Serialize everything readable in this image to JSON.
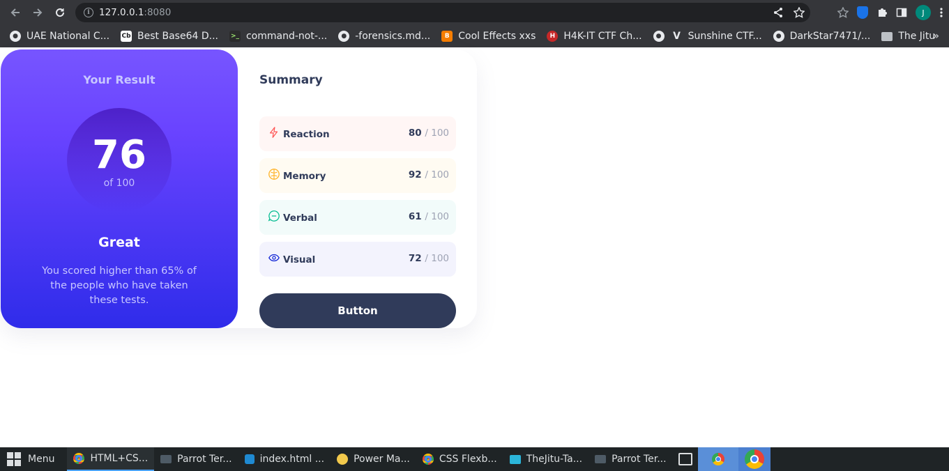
{
  "browser": {
    "url_host": "127.0.0.1",
    "url_port": ":8080",
    "avatar_letter": "J",
    "bookmarks": [
      {
        "label": "UAE National C...",
        "icon": "globe-icon",
        "color": "#e8eaed"
      },
      {
        "label": "Best Base64 D...",
        "icon": "cb-icon",
        "color": "#ffffff"
      },
      {
        "label": "command-not-...",
        "icon": "terminal-icon",
        "color": "#2b2b2b"
      },
      {
        "label": "-forensics.md...",
        "icon": "github-icon",
        "color": "#e8eaed"
      },
      {
        "label": "Cool Effects xxs",
        "icon": "blogger-icon",
        "color": "#f57d00"
      },
      {
        "label": "H4K-IT CTF Ch...",
        "icon": "ctf-icon",
        "color": "#c62828"
      },
      {
        "label": "",
        "icon": "globe-icon",
        "color": "#e8eaed"
      },
      {
        "label": "Sunshine CTF...",
        "icon": "v-icon",
        "color": "#e8eaed"
      },
      {
        "label": "DarkStar7471/...",
        "icon": "github-icon",
        "color": "#e8eaed"
      },
      {
        "label": "The Jitu",
        "icon": "folder-icon",
        "color": "#bdc1c6"
      }
    ],
    "bookmarks_more": "»"
  },
  "result": {
    "title": "Your Result",
    "score": "76",
    "of_total": "of 100",
    "rating": "Great",
    "message": "You scored higher than 65% of the people who have taken these tests."
  },
  "summary": {
    "title": "Summary",
    "items": [
      {
        "label": "Reaction",
        "score": "80",
        "total": "/ 100",
        "icon": "lightning-icon",
        "color": "#ff5757",
        "bg": "#fff6f5"
      },
      {
        "label": "Memory",
        "score": "92",
        "total": "/ 100",
        "icon": "brain-icon",
        "color": "#ffb01f",
        "bg": "#fffbf2"
      },
      {
        "label": "Verbal",
        "score": "61",
        "total": "/ 100",
        "icon": "chat-icon",
        "color": "#00bb8f",
        "bg": "#f2fbfa"
      },
      {
        "label": "Visual",
        "score": "72",
        "total": "/ 100",
        "icon": "eye-icon",
        "color": "#1125d6",
        "bg": "#f3f3fd"
      }
    ],
    "button_label": "Button"
  },
  "taskbar": {
    "menu_label": "Menu",
    "items": [
      {
        "label": "HTML+CS...",
        "icon": "chrome-icon",
        "active": true
      },
      {
        "label": "Parrot Ter...",
        "icon": "terminal-icon",
        "active": false
      },
      {
        "label": "index.html ...",
        "icon": "vscode-icon",
        "active": false
      },
      {
        "label": "Power Ma...",
        "icon": "power-icon",
        "active": false
      },
      {
        "label": "CSS Flexb...",
        "icon": "chrome-icon",
        "active": false
      },
      {
        "label": "TheJitu-Ta...",
        "icon": "folder-icon",
        "active": false
      },
      {
        "label": "Parrot Ter...",
        "icon": "terminal-icon",
        "active": false
      }
    ]
  }
}
